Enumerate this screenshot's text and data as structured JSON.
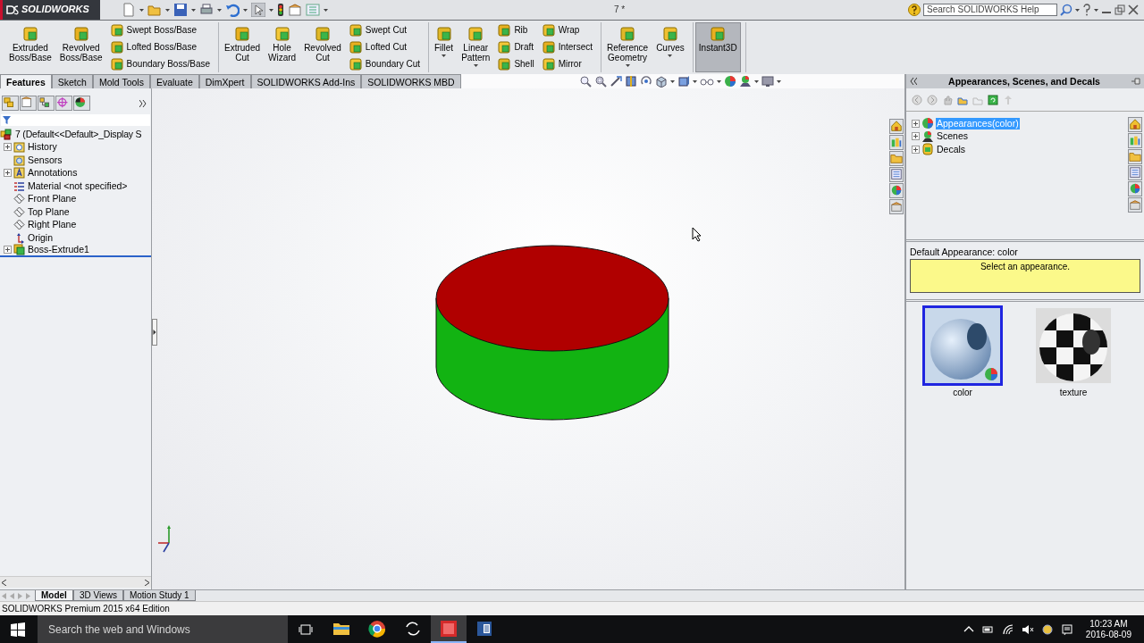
{
  "window": {
    "logo": "SOLIDWORKS",
    "title": "7 *"
  },
  "help_search": {
    "placeholder": "Search SOLIDWORKS Help"
  },
  "ribbon": [
    [
      {
        "kind": "large",
        "label": "Extruded Boss/Base",
        "dropdown": false,
        "pressed": false
      },
      {
        "kind": "large",
        "label": "Revolved Boss/Base",
        "dropdown": false,
        "pressed": false
      },
      {
        "kind": "stack",
        "items": [
          "Swept Boss/Base",
          "Lofted Boss/Base",
          "Boundary Boss/Base"
        ]
      }
    ],
    [
      {
        "kind": "large",
        "label": "Extruded Cut",
        "dropdown": false,
        "pressed": false
      },
      {
        "kind": "large",
        "label": "Hole Wizard",
        "dropdown": false,
        "pressed": false
      },
      {
        "kind": "large",
        "label": "Revolved Cut",
        "dropdown": false,
        "pressed": false
      },
      {
        "kind": "stack",
        "items": [
          "Swept Cut",
          "Lofted Cut",
          "Boundary Cut"
        ]
      }
    ],
    [
      {
        "kind": "large",
        "label": "Fillet",
        "dropdown": true,
        "pressed": false
      },
      {
        "kind": "large",
        "label": "Linear Pattern",
        "dropdown": true,
        "pressed": false
      },
      {
        "kind": "stack",
        "items": [
          "Rib",
          "Draft",
          "Shell"
        ]
      },
      {
        "kind": "stack",
        "items": [
          "Wrap",
          "Intersect",
          "Mirror"
        ]
      }
    ],
    [
      {
        "kind": "large",
        "label": "Reference Geometry",
        "dropdown": true,
        "pressed": false
      },
      {
        "kind": "large",
        "label": "Curves",
        "dropdown": true,
        "pressed": false
      }
    ],
    [
      {
        "kind": "large",
        "label": "Instant3D",
        "dropdown": false,
        "pressed": true
      }
    ]
  ],
  "command_tabs": [
    {
      "label": "Features",
      "selected": true
    },
    {
      "label": "Sketch",
      "selected": false
    },
    {
      "label": "Mold Tools",
      "selected": false
    },
    {
      "label": "Evaluate",
      "selected": false
    },
    {
      "label": "DimXpert",
      "selected": false
    },
    {
      "label": "SOLIDWORKS Add-Ins",
      "selected": false
    },
    {
      "label": "SOLIDWORKS MBD",
      "selected": false
    }
  ],
  "feature_tree": {
    "root": "7 (Default<<Default>_Display S",
    "children": [
      {
        "kind": "history",
        "label": "History",
        "expandable": true
      },
      {
        "kind": "sensors",
        "label": "Sensors",
        "expandable": false
      },
      {
        "kind": "annotations",
        "label": "Annotations",
        "expandable": true
      },
      {
        "kind": "material",
        "label": "Material <not specified>",
        "expandable": false
      },
      {
        "kind": "plane",
        "label": "Front Plane",
        "expandable": false
      },
      {
        "kind": "plane",
        "label": "Top Plane",
        "expandable": false
      },
      {
        "kind": "plane",
        "label": "Right Plane",
        "expandable": false
      },
      {
        "kind": "origin",
        "label": "Origin",
        "expandable": false
      },
      {
        "kind": "feature",
        "label": "Boss-Extrude1",
        "expandable": true
      }
    ]
  },
  "task_pane": {
    "title": "Appearances, Scenes, and Decals",
    "tree": [
      {
        "kind": "appearances",
        "label": "Appearances(color)",
        "selected": true,
        "expandable": true
      },
      {
        "kind": "scenes",
        "label": "Scenes",
        "selected": false,
        "expandable": true
      },
      {
        "kind": "decals",
        "label": "Decals",
        "selected": false,
        "expandable": true
      }
    ],
    "default_label": "Default Appearance: color",
    "message": "Select an appearance.",
    "thumbnails": [
      {
        "kind": "glossy",
        "label": "color",
        "selected": true
      },
      {
        "kind": "checker",
        "label": "texture",
        "selected": false
      }
    ]
  },
  "bottom_tabs": [
    {
      "label": "Model",
      "selected": true
    },
    {
      "label": "3D Views",
      "selected": false
    },
    {
      "label": "Motion Study 1",
      "selected": false
    }
  ],
  "status_bar": {
    "text": "SOLIDWORKS Premium 2015 x64 Edition"
  },
  "taskbar": {
    "search_placeholder": "Search the web and Windows",
    "apps": [
      {
        "kind": "explorer",
        "active": false
      },
      {
        "kind": "browser",
        "active": false
      },
      {
        "kind": "app",
        "active": false
      },
      {
        "kind": "solidworks",
        "active": true
      },
      {
        "kind": "word",
        "active": false
      }
    ],
    "time": "10:23 AM",
    "date": "2016-08-09"
  }
}
